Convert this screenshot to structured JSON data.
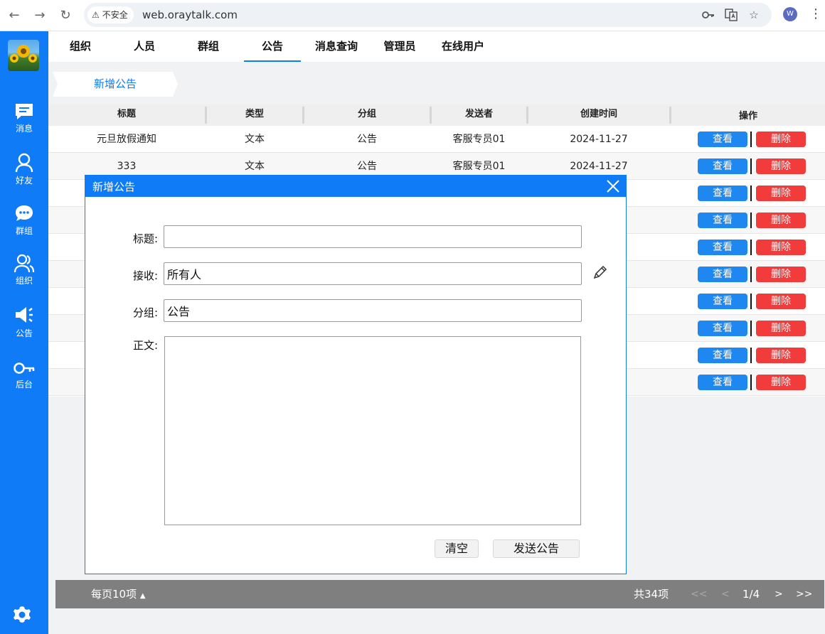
{
  "browser": {
    "security_label": "不安全",
    "url": "web.oraytalk.com",
    "profile_initial": "W"
  },
  "sidebar": {
    "items": [
      {
        "label": "消息",
        "icon": "message-icon"
      },
      {
        "label": "好友",
        "icon": "user-icon"
      },
      {
        "label": "群组",
        "icon": "chat-group-icon"
      },
      {
        "label": "组织",
        "icon": "users-icon"
      },
      {
        "label": "公告",
        "icon": "megaphone-icon"
      },
      {
        "label": "后台",
        "icon": "key-icon"
      }
    ],
    "settings_icon": "gear-icon"
  },
  "tabs": [
    "组织",
    "人员",
    "群组",
    "公告",
    "消息查询",
    "管理员",
    "在线用户"
  ],
  "active_tab": "公告",
  "sub_tab": "新增公告",
  "table": {
    "headers": [
      "标题",
      "类型",
      "分组",
      "发送者",
      "创建时间",
      "操作"
    ],
    "rows": [
      {
        "title": "元旦放假通知",
        "type": "文本",
        "group": "公告",
        "sender": "客服专员01",
        "created": "2024-11-27"
      },
      {
        "title": "333",
        "type": "文本",
        "group": "公告",
        "sender": "客服专员01",
        "created": "2024-11-27"
      }
    ],
    "view_label": "查看",
    "delete_label": "删除",
    "total_rows_shown": 10
  },
  "pager": {
    "per_page": "每页10项",
    "total": "共34项",
    "first": "<<",
    "prev": "<",
    "current": "1/4",
    "next": ">",
    "last": ">>"
  },
  "modal": {
    "title": "新增公告",
    "title_label": "标题:",
    "title_value": "",
    "receiver_label": "接收:",
    "receiver_value": "所有人",
    "group_label": "分组:",
    "group_value": "公告",
    "body_label": "正文:",
    "body_value": "",
    "clear_label": "清空",
    "send_label": "发送公告"
  },
  "colors": {
    "primary": "#0f7bf7",
    "view_button": "#1e88f0",
    "delete_button": "#f23b3b",
    "pager_bg": "#7f7f7f"
  }
}
